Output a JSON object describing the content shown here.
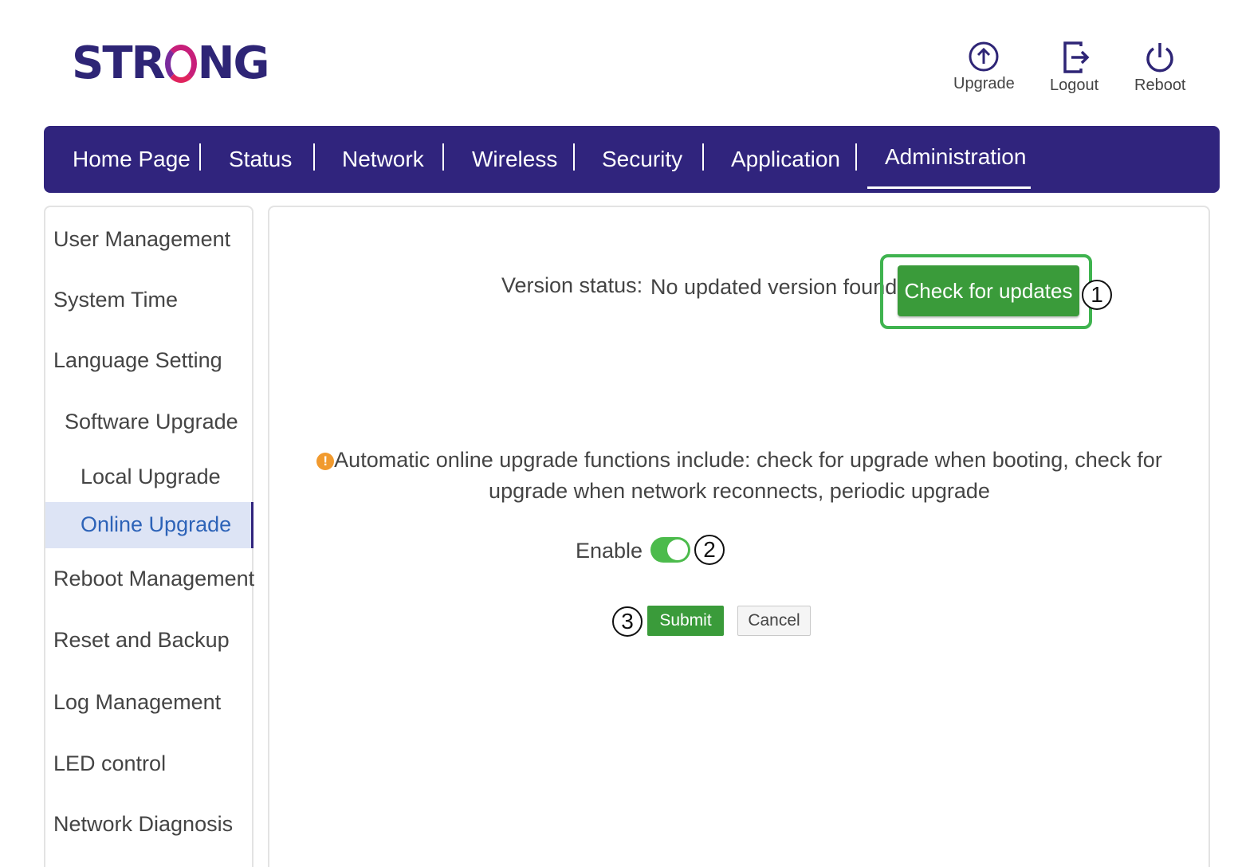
{
  "logo": {
    "brand_text_before": "STR",
    "brand_text_after": "NG",
    "accent": "#c71f7a",
    "brand_color": "#2e2576"
  },
  "toolbar": {
    "upgrade_label": "Upgrade",
    "logout_label": "Logout",
    "reboot_label": "Reboot"
  },
  "nav": {
    "background": "#30247d",
    "active": "Administration",
    "items": [
      "Home Page",
      "Status",
      "Network",
      "Wireless",
      "Security",
      "Application",
      "Administration"
    ]
  },
  "sidebar": {
    "items": [
      "User Management",
      "System Time",
      "Language Setting",
      "Software Upgrade",
      "Local Upgrade",
      "Online Upgrade",
      "Reboot Management",
      "Reset and Backup",
      "Log Management",
      "LED control",
      "Network Diagnosis"
    ],
    "active": "Online Upgrade"
  },
  "main": {
    "version_label": "Version status:",
    "version_value": "No updated version found",
    "check_button": "Check for updates",
    "info_icon": "info-icon",
    "info_text": "Automatic online upgrade functions include: check for upgrade when booting, check for upgrade when network reconnects, periodic upgrade",
    "enable_label": "Enable",
    "enable_state": true,
    "submit_label": "Submit",
    "cancel_label": "Cancel",
    "primary_color": "#3a9b3a",
    "highlight_color": "#3fb34f"
  },
  "callouts": [
    "1",
    "2",
    "3"
  ]
}
